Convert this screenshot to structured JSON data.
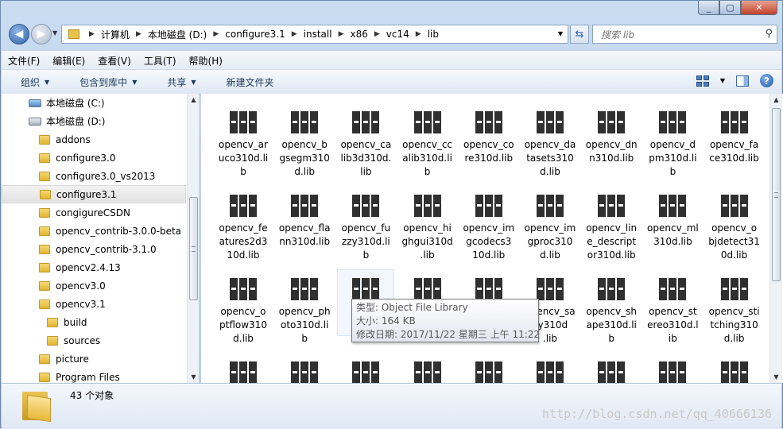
{
  "window": {
    "controls": [
      "_",
      "▢",
      "✕"
    ]
  },
  "address": {
    "crumbs": [
      "计算机",
      "本地磁盘 (D:)",
      "configure3.1",
      "install",
      "x86",
      "vc14",
      "lib"
    ]
  },
  "search": {
    "placeholder": "搜索 lib"
  },
  "menu": [
    "文件(F)",
    "编辑(E)",
    "查看(V)",
    "工具(T)",
    "帮助(H)"
  ],
  "toolbar": {
    "organize": "组织",
    "include_in_library": "包含到库中",
    "share": "共享",
    "new_folder": "新建文件夹"
  },
  "tree": [
    {
      "label": "本地磁盘 (C:)",
      "type": "sysdrive",
      "indent": 1
    },
    {
      "label": "本地磁盘 (D:)",
      "type": "drive",
      "indent": 1
    },
    {
      "label": "addons",
      "type": "folder",
      "indent": 2
    },
    {
      "label": "configure3.0",
      "type": "folder",
      "indent": 2
    },
    {
      "label": "configure3.0_vs2013",
      "type": "folder",
      "indent": 2
    },
    {
      "label": "configure3.1",
      "type": "folder",
      "indent": 2,
      "selected": true
    },
    {
      "label": "congigureCSDN",
      "type": "folder",
      "indent": 2
    },
    {
      "label": "opencv_contrib-3.0.0-beta",
      "type": "folder",
      "indent": 2
    },
    {
      "label": "opencv_contrib-3.1.0",
      "type": "folder",
      "indent": 2
    },
    {
      "label": "opencv2.4.13",
      "type": "folder",
      "indent": 2
    },
    {
      "label": "opencv3.0",
      "type": "folder",
      "indent": 2
    },
    {
      "label": "opencv3.1",
      "type": "folder",
      "indent": 2
    },
    {
      "label": "build",
      "type": "folder",
      "indent": 3
    },
    {
      "label": "sources",
      "type": "folder",
      "indent": 3
    },
    {
      "label": "picture",
      "type": "folder",
      "indent": 2
    },
    {
      "label": "Program Files",
      "type": "folder",
      "indent": 2
    }
  ],
  "files": [
    [
      "opencv_ar",
      "uco310d.li",
      "b"
    ],
    [
      "opencv_b",
      "gsegm310",
      "d.lib"
    ],
    [
      "opencv_ca",
      "lib3d310d.",
      "lib"
    ],
    [
      "opencv_cc",
      "alib310d.li",
      "b"
    ],
    [
      "opencv_co",
      "re310d.lib"
    ],
    [
      "opencv_da",
      "tasets310",
      "d.lib"
    ],
    [
      "opencv_dn",
      "n310d.lib"
    ],
    [
      "opencv_d",
      "pm310d.li",
      "b"
    ],
    [
      "opencv_fa",
      "ce310d.lib"
    ],
    [
      "opencv_fe",
      "atures2d3",
      "10d.lib"
    ],
    [
      "opencv_fla",
      "nn310d.lib"
    ],
    [
      "opencv_fu",
      "zzy310d.li",
      "b"
    ],
    [
      "opencv_hi",
      "ghgui310d",
      ".lib"
    ],
    [
      "opencv_im",
      "gcodecs3",
      "10d.lib"
    ],
    [
      "opencv_im",
      "gproc310",
      "d.lib"
    ],
    [
      "opencv_lin",
      "e_descript",
      "or310d.lib"
    ],
    [
      "opencv_ml",
      "310d.lib"
    ],
    [
      "opencv_o",
      "bjdetect31",
      "0d.lib"
    ],
    [
      "opencv_o",
      "ptflow310",
      "d.lib"
    ],
    [
      "opencv_ph",
      "oto310d.li",
      "b"
    ],
    [
      "op",
      "ot"
    ],
    [
      ""
    ],
    [
      ""
    ],
    [
      "opencv_sa",
      "cy310d",
      ".lib"
    ],
    [
      "opencv_sh",
      "ape310d.li",
      "b"
    ],
    [
      "opencv_st",
      "ereo310d.l",
      "ib"
    ],
    [
      "opencv_sti",
      "tching310",
      "d.lib"
    ],
    [
      ""
    ],
    [
      ""
    ],
    [
      ""
    ],
    [
      ""
    ],
    [
      ""
    ],
    [
      ""
    ],
    [
      ""
    ],
    [
      ""
    ],
    [
      ""
    ]
  ],
  "tooltip": {
    "type": "类型: Object File Library",
    "size": "大小: 164 KB",
    "modified": "修改日期: 2017/11/22 星期三 上午 11:22"
  },
  "status": {
    "count": "43 个对象"
  },
  "watermark": "http://blog.csdn.net/qq_40666136"
}
